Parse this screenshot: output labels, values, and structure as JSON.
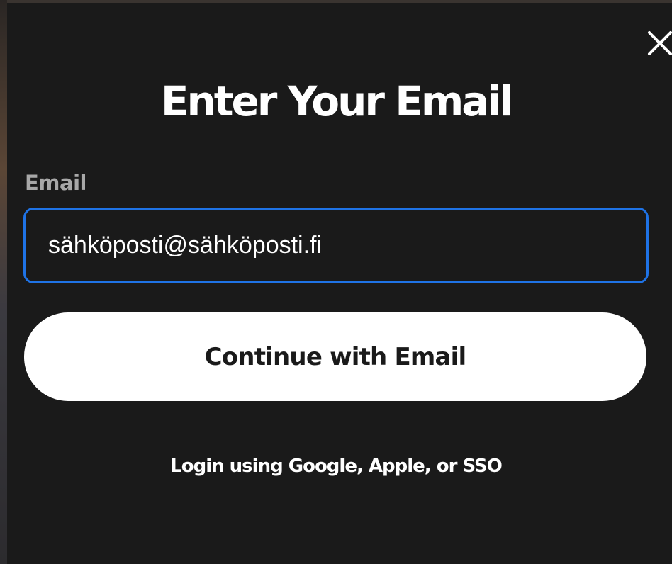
{
  "modal": {
    "title": "Enter Your Email",
    "close_icon": "close-icon",
    "email_label": "Email",
    "email_value": "sähköposti@sähköposti.fi",
    "continue_label": "Continue with Email",
    "alt_login_label": "Login using Google, Apple, or SSO"
  },
  "colors": {
    "modal_background": "#1a1a1a",
    "input_focus_border": "#1f73e6",
    "button_background": "#ffffff",
    "label_text": "#a8a8a8"
  }
}
